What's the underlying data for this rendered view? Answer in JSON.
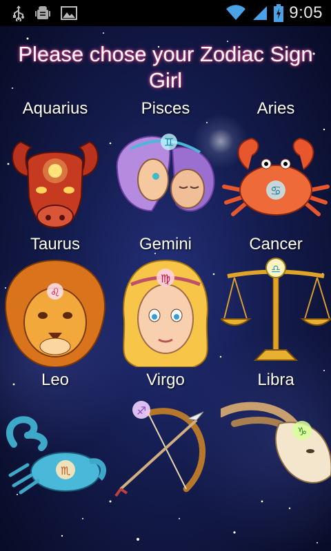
{
  "status_bar": {
    "time": "9:05",
    "icons": [
      "usb-icon",
      "android-debug-icon",
      "image-icon",
      "wifi-icon",
      "signal-icon",
      "battery-icon"
    ]
  },
  "title": "Please chose your Zodiac Sign Girl",
  "signs": [
    {
      "label": "Aquarius",
      "image": "taurus-bull-icon"
    },
    {
      "label": "Pisces",
      "image": "gemini-twins-icon"
    },
    {
      "label": "Aries",
      "image": "cancer-crab-icon"
    },
    {
      "label": "Taurus",
      "image": "leo-lion-icon"
    },
    {
      "label": "Gemini",
      "image": "virgo-girl-icon"
    },
    {
      "label": "Cancer",
      "image": "libra-scales-icon"
    },
    {
      "label": "Leo",
      "image": "scorpio-scorpion-icon"
    },
    {
      "label": "Virgo",
      "image": "sagittarius-bow-icon"
    },
    {
      "label": "Libra",
      "image": "capricorn-goat-icon"
    }
  ],
  "colors": {
    "title_glow": "#ff4fa8",
    "status_bar": "#000000",
    "background": "#141c4e"
  }
}
